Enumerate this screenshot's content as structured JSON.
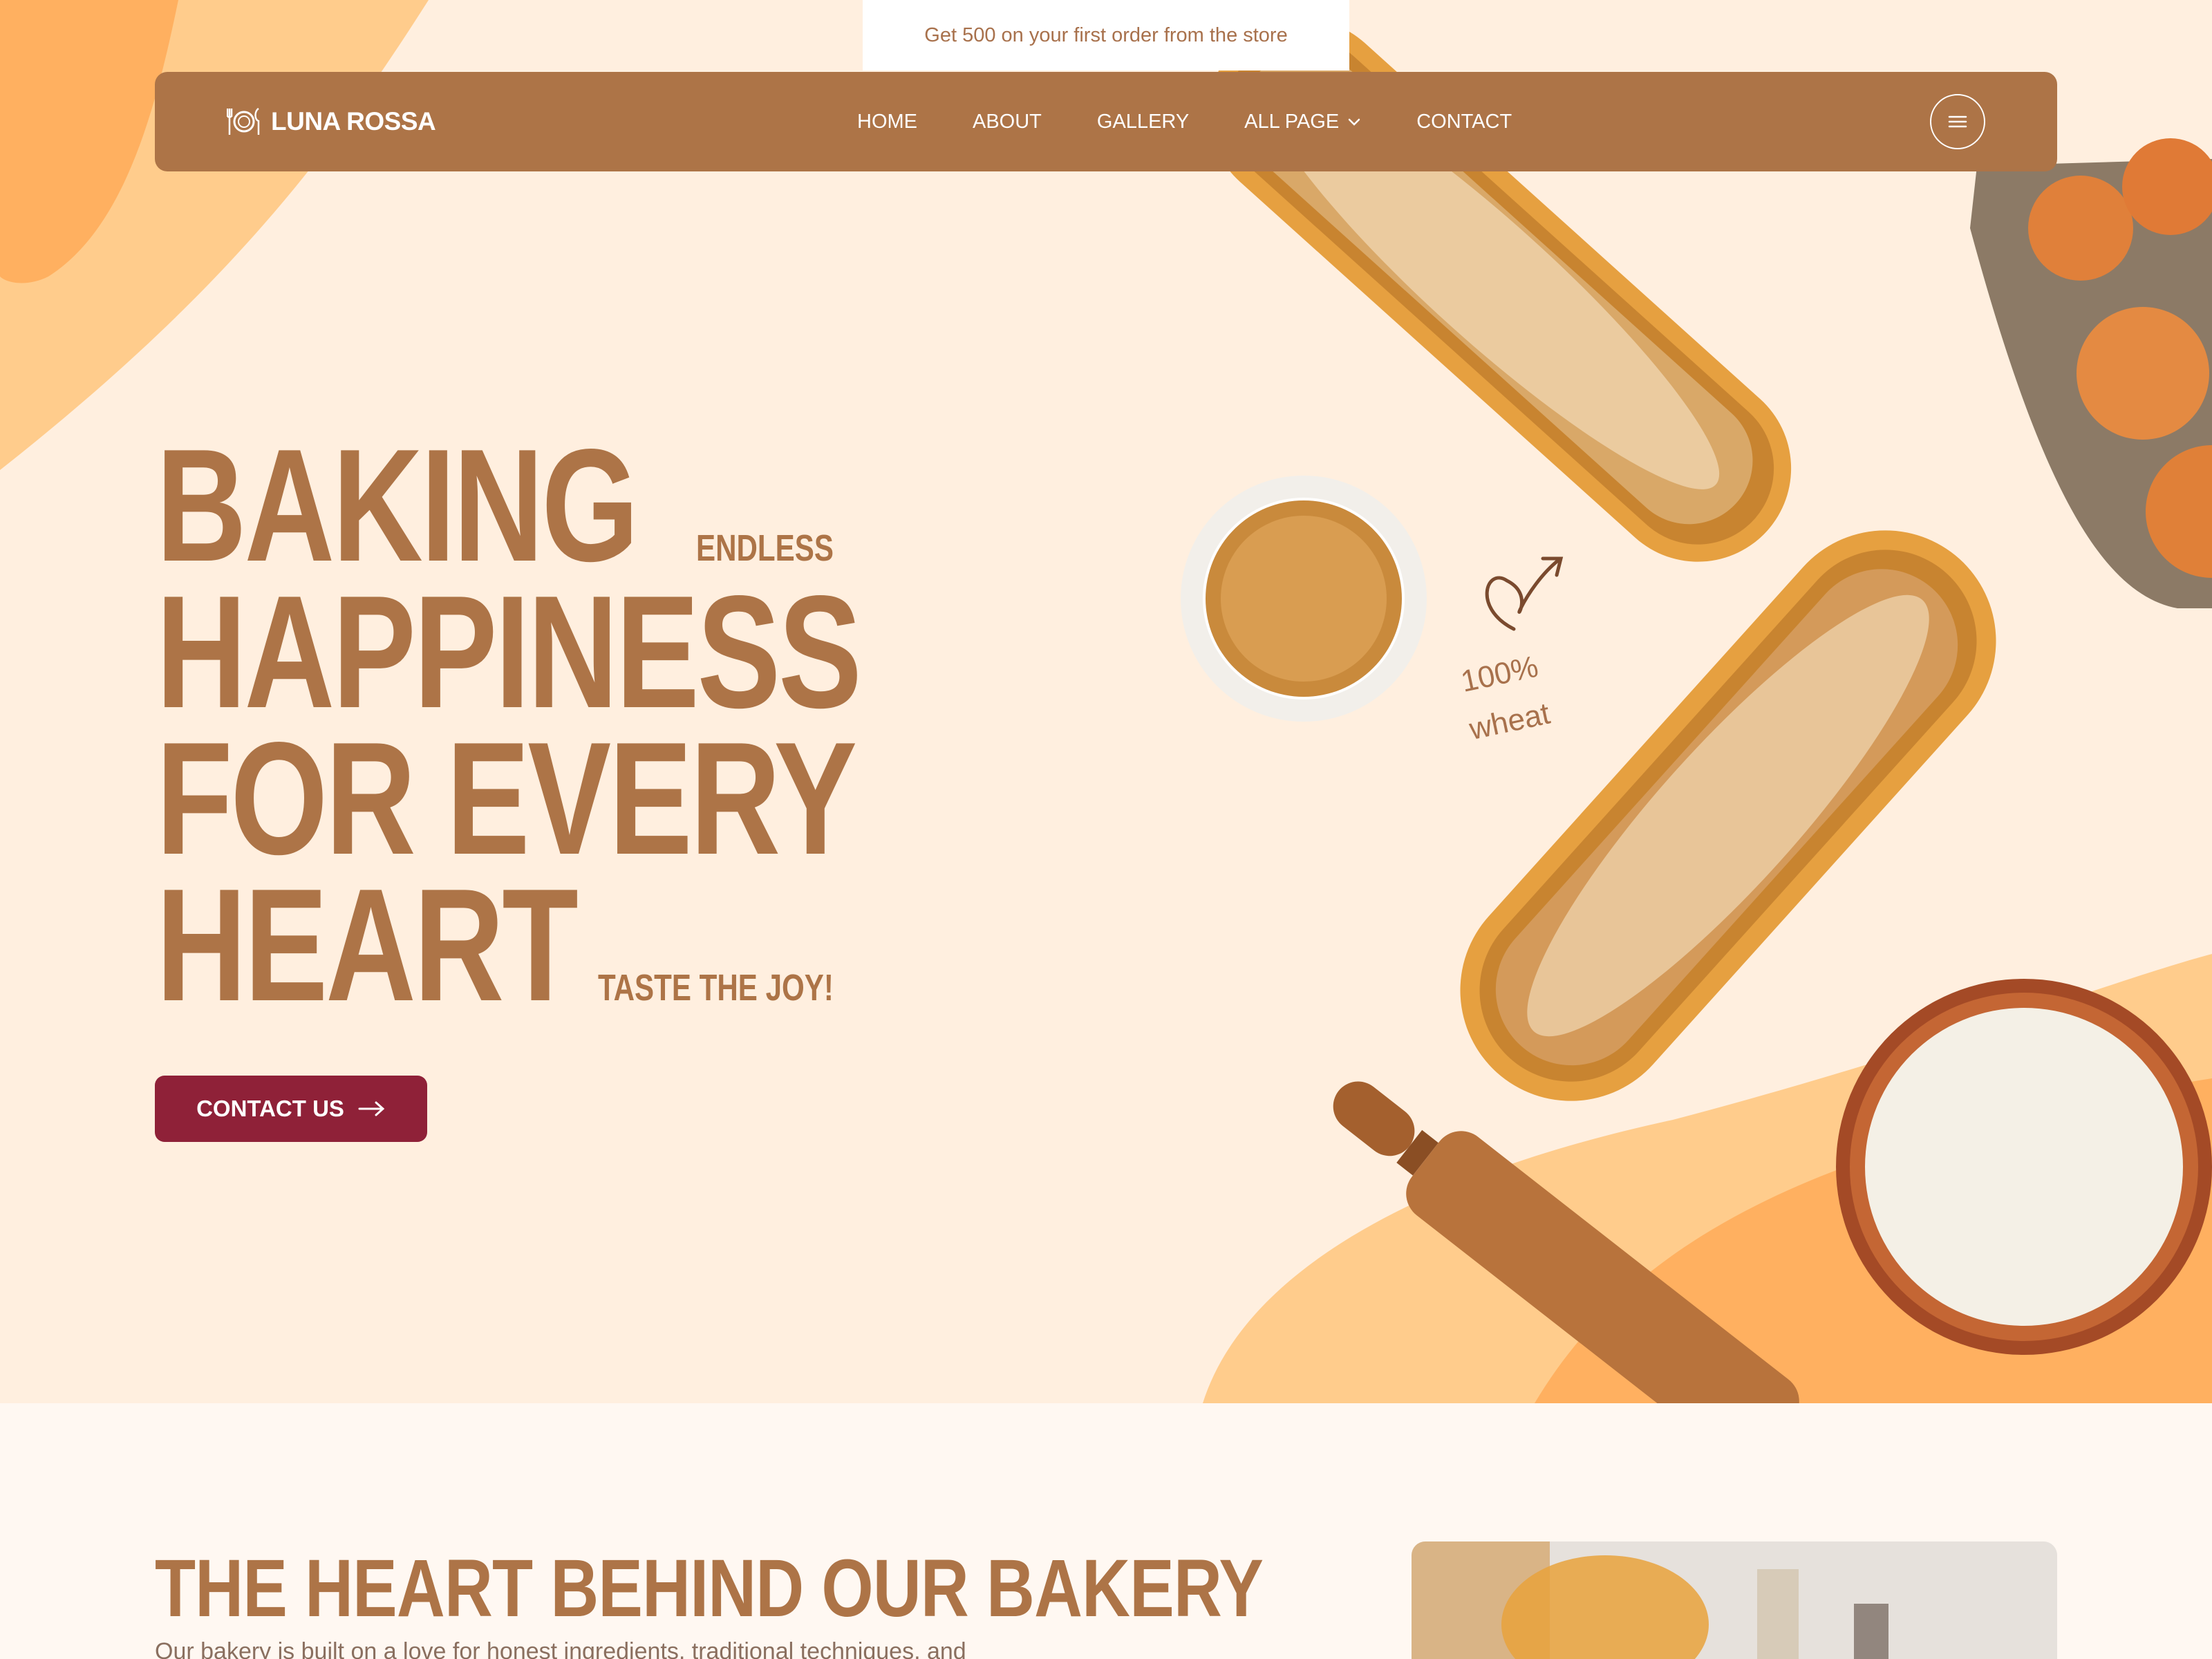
{
  "announcement": {
    "text": "Get 500 on your first order from the store"
  },
  "brand": {
    "name": "LUNA ROSSA",
    "logo_icon": "plate-cutlery-icon"
  },
  "nav": {
    "items": [
      {
        "label": "HOME"
      },
      {
        "label": "ABOUT"
      },
      {
        "label": "GALLERY"
      },
      {
        "label": "ALL PAGE",
        "has_dropdown": true
      },
      {
        "label": "CONTACT"
      }
    ],
    "menu_icon": "hamburger-icon"
  },
  "hero": {
    "line1": "BAKING",
    "line1_small": "ENDLESS",
    "line2": "HAPPINESS",
    "line3": "FOR EVERY",
    "line4": "HEART",
    "line4_small": "TASTE THE JOY!",
    "cta_label": "CONTACT US",
    "annotation_line1": "100%",
    "annotation_line2": "wheat"
  },
  "about": {
    "title": "THE HEART BEHIND OUR BAKERY",
    "body": "Our bakery is built on a love for honest ingredients, traditional techniques, and"
  },
  "colors": {
    "background": "#ffefdf",
    "brand_brown": "#ad7447",
    "accent_orange": "#ffb064",
    "cta_maroon": "#8f2138"
  }
}
